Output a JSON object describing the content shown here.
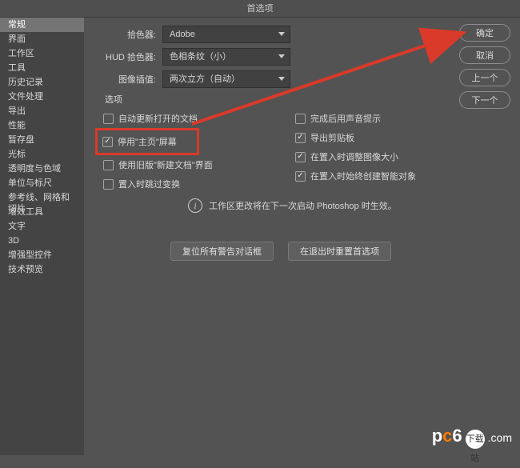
{
  "title": "首选项",
  "sidebar": {
    "items": [
      {
        "label": "常规",
        "selected": true
      },
      {
        "label": "界面"
      },
      {
        "label": "工作区"
      },
      {
        "label": "工具"
      },
      {
        "label": "历史记录"
      },
      {
        "label": "文件处理"
      },
      {
        "label": "导出"
      },
      {
        "label": "性能"
      },
      {
        "label": "暂存盘"
      },
      {
        "label": "光标"
      },
      {
        "label": "透明度与色域"
      },
      {
        "label": "单位与标尺"
      },
      {
        "label": "参考线、网格和切片"
      },
      {
        "label": "增效工具"
      },
      {
        "label": "文字"
      },
      {
        "label": "3D"
      },
      {
        "label": "增强型控件"
      },
      {
        "label": "技术预览"
      }
    ]
  },
  "buttons": {
    "ok": "确定",
    "cancel": "取消",
    "prev": "上一个",
    "next": "下一个"
  },
  "pickers": {
    "colorPicker": {
      "label": "拾色器:",
      "value": "Adobe"
    },
    "hudPicker": {
      "label": "HUD 拾色器:",
      "value": "色相条纹（小）"
    },
    "interpolation": {
      "label": "图像插值:",
      "value": "两次立方（自动）"
    }
  },
  "optionsGroup": "选项",
  "optionsLeft": [
    {
      "label": "自动更新打开的文档",
      "checked": false
    },
    {
      "label": "停用\"主页\"屏幕",
      "checked": true,
      "highlight": true
    },
    {
      "label": "使用旧版\"新建文档\"界面",
      "checked": false
    },
    {
      "label": "置入时跳过变换",
      "checked": false
    }
  ],
  "optionsRight": [
    {
      "label": "完成后用声音提示",
      "checked": false
    },
    {
      "label": "导出剪贴板",
      "checked": true
    },
    {
      "label": "在置入时调整图像大小",
      "checked": true
    },
    {
      "label": "在置入时始终创建智能对象",
      "checked": true
    }
  ],
  "infoNote": "工作区更改将在下一次启动 Photoshop 时生效。",
  "actions": {
    "resetWarnings": "复位所有警告对话框",
    "resetOnQuit": "在退出时重置首选项"
  },
  "watermark": {
    "badge": "下载站",
    "p": "p",
    "c": "c",
    "six": "6",
    "com": ".com"
  }
}
